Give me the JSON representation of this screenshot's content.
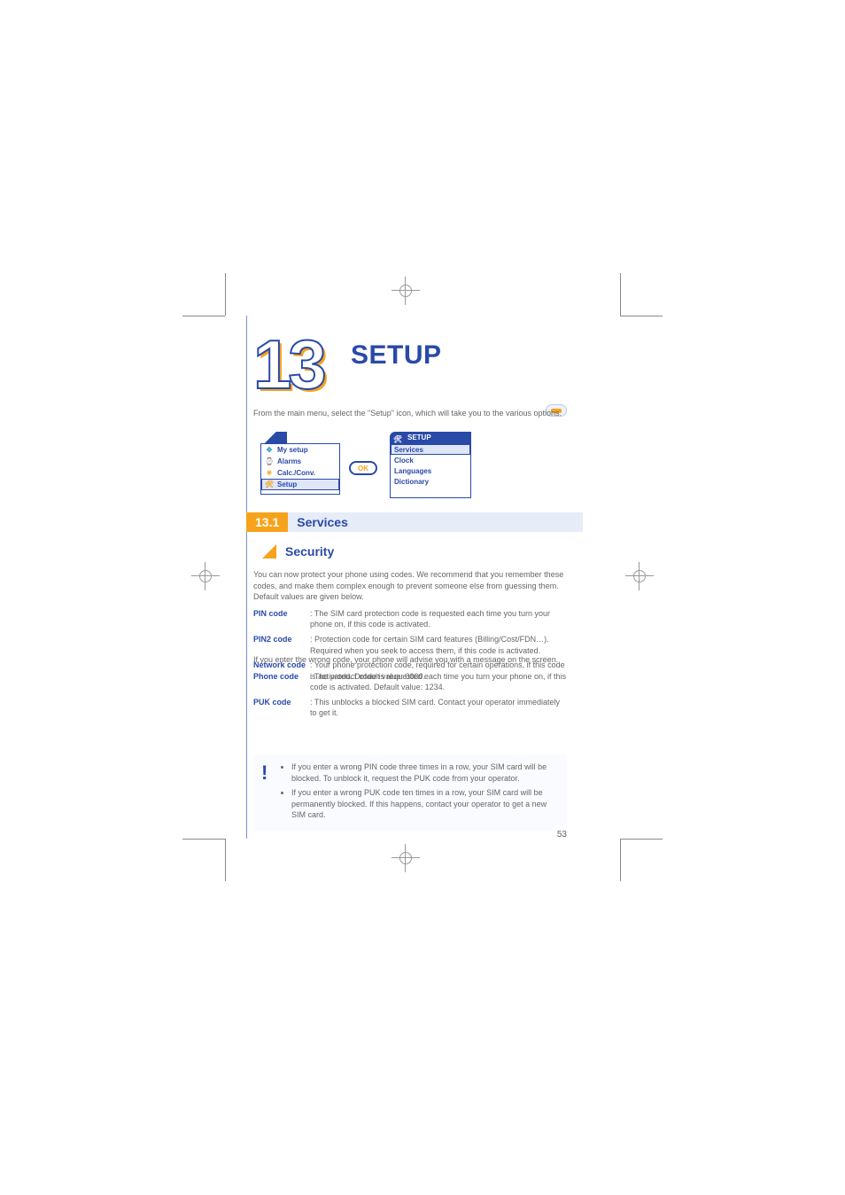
{
  "chapter": {
    "number": "13",
    "title": "SETUP"
  },
  "intro": "From the main menu, select the \"Setup\" icon, which will take you to the various options.",
  "menu_left": {
    "items": [
      {
        "label": "My setup",
        "icon": "✥"
      },
      {
        "label": "Alarms",
        "icon": "⌚"
      },
      {
        "label": "Calc./Conv.",
        "icon": "✳"
      },
      {
        "label": "Setup",
        "icon": "🛠"
      }
    ]
  },
  "ok_label": "OK",
  "menu_right": {
    "title": "SETUP",
    "items": [
      {
        "label": "Services"
      },
      {
        "label": "Clock"
      },
      {
        "label": "Languages"
      },
      {
        "label": "Dictionary"
      }
    ]
  },
  "section": {
    "number": "13.1",
    "title": "Services"
  },
  "subheading": "Security",
  "body1": {
    "lead": "You can now protect your phone using codes. We recommend that you remember these codes, and make them complex enough to prevent someone else from guessing them. Default values are given below.",
    "items": [
      {
        "k": "PIN code",
        "v": "The SIM card protection code is requested each time you turn your phone on, if this code is activated."
      },
      {
        "k": "PIN2 code",
        "v": "Protection code for certain SIM card features (Billing/Cost/FDN…). Required when you seek to access them, if this code is activated."
      },
      {
        "k": "Network code",
        "v": "Your phone protection code, required for certain operations, if this code is activated. Default value: 0000."
      }
    ]
  },
  "body2": {
    "lead": "If you enter the wrong code, your phone will advise you with a message on the screen.",
    "items": [
      {
        "k": "Phone code",
        "v": "The product code is requested each time you turn your phone on, if this code is activated. Default value: 1234."
      },
      {
        "k": "PUK code",
        "v": "This unblocks a blocked SIM card. Contact your operator immediately to get it."
      }
    ]
  },
  "note": {
    "items": [
      "If you enter a wrong PIN code three times in a row, your SIM card will be blocked. To unblock it, request the PUK code from your operator.",
      "If you enter a wrong PUK code ten times in a row, your SIM card will be permanently blocked. If this happens, contact your operator to get a new SIM card."
    ]
  },
  "page_number": "53"
}
